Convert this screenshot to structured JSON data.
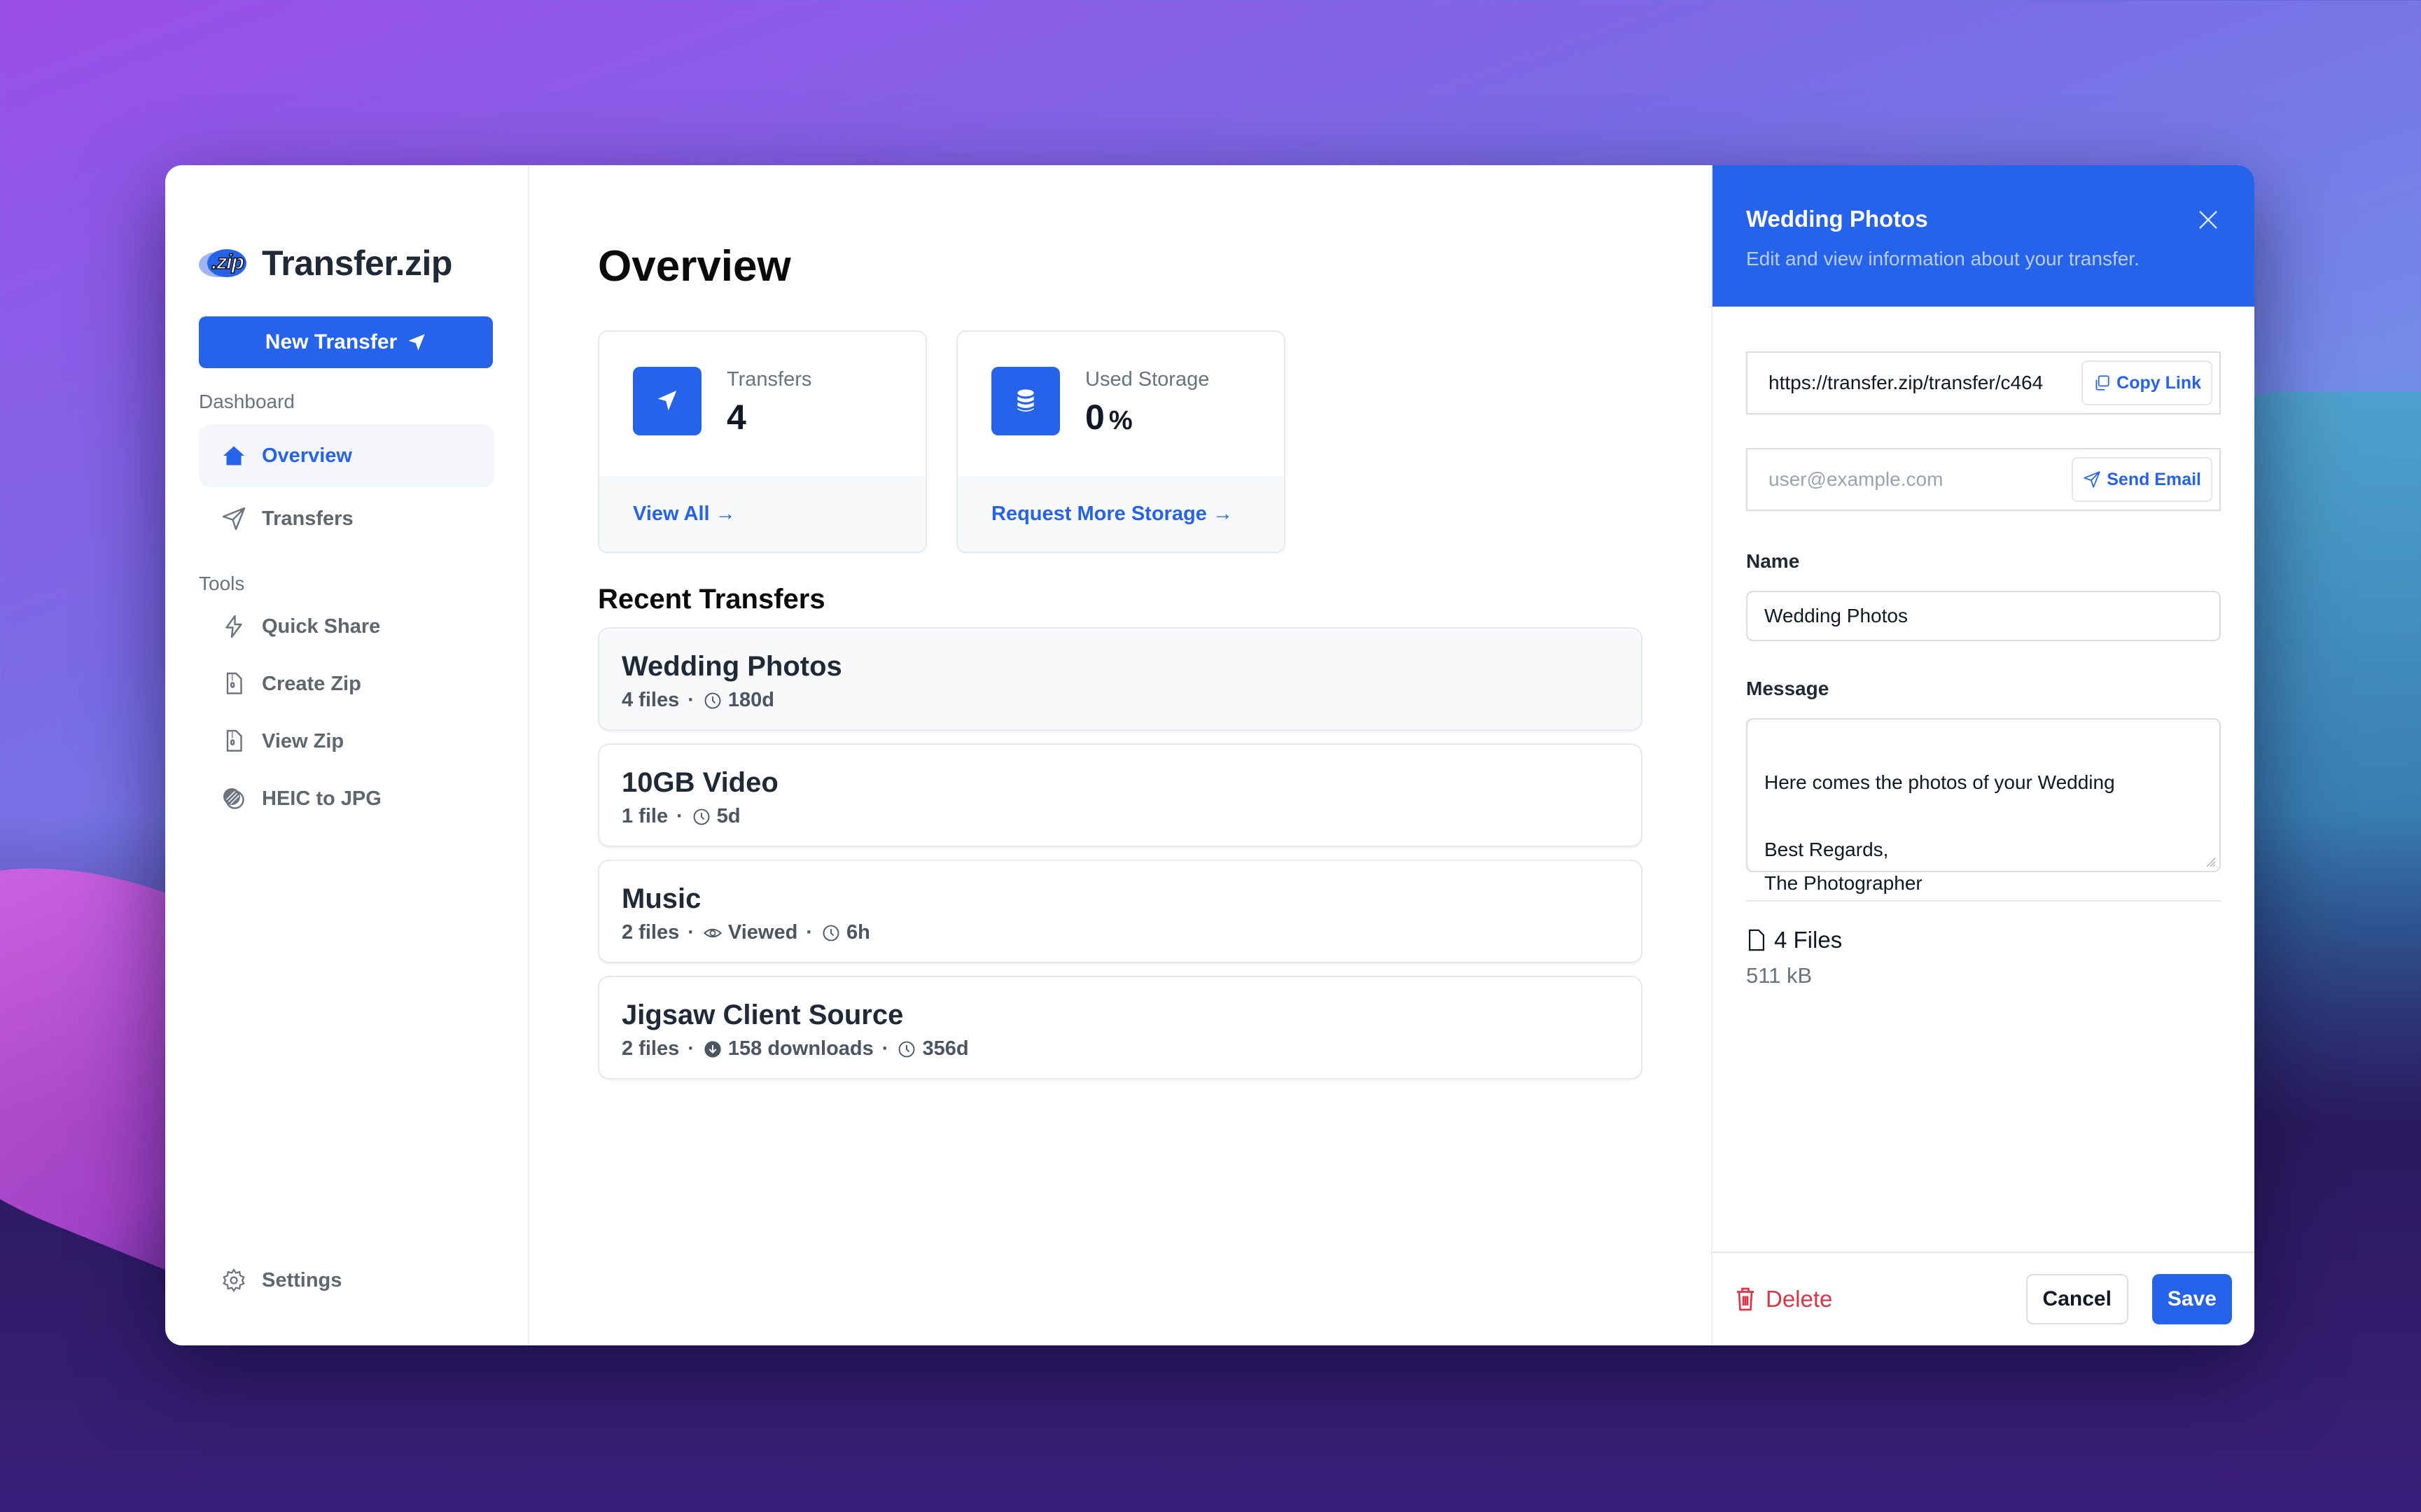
{
  "app": {
    "brand_logo_text": ".zip",
    "brand_name": "Transfer.zip",
    "accent_color": "#2563eb",
    "danger_color": "#dc3545"
  },
  "sidebar": {
    "new_transfer_label": "New Transfer",
    "dashboard_label": "Dashboard",
    "dashboard_items": [
      {
        "label": "Overview",
        "icon": "home-icon",
        "active": true
      },
      {
        "label": "Transfers",
        "icon": "paper-plane-icon",
        "active": false
      }
    ],
    "tools_label": "Tools",
    "tool_items": [
      {
        "label": "Quick Share",
        "icon": "bolt-icon"
      },
      {
        "label": "Create Zip",
        "icon": "zip-file-icon"
      },
      {
        "label": "View Zip",
        "icon": "zip-file-icon"
      },
      {
        "label": "HEIC to JPG",
        "icon": "image-convert-icon"
      }
    ],
    "settings_label": "Settings"
  },
  "main": {
    "title": "Overview",
    "stats": [
      {
        "label": "Transfers",
        "value": "4",
        "unit": "",
        "link": "View All →",
        "icon": "paper-plane-icon"
      },
      {
        "label": "Used Storage",
        "value": "0",
        "unit": "%",
        "link": "Request More Storage →",
        "icon": "database-icon"
      }
    ],
    "recent_title": "Recent Transfers",
    "transfers": [
      {
        "name": "Wedding Photos",
        "files": "4 files",
        "viewed": null,
        "downloads": null,
        "expires": "180d",
        "selected": true
      },
      {
        "name": "10GB Video",
        "files": "1 file",
        "viewed": null,
        "downloads": null,
        "expires": "5d",
        "selected": false
      },
      {
        "name": "Music",
        "files": "2 files",
        "viewed": "Viewed",
        "downloads": null,
        "expires": "6h",
        "selected": false
      },
      {
        "name": "Jigsaw Client Source",
        "files": "2 files",
        "viewed": null,
        "downloads": "158 downloads",
        "expires": "356d",
        "selected": false
      }
    ]
  },
  "panel": {
    "title": "Wedding Photos",
    "subtitle": "Edit and view information about your transfer.",
    "link_value": "https://transfer.zip/transfer/c464",
    "copy_link_label": "Copy Link",
    "email_placeholder": "user@example.com",
    "send_email_label": "Send Email",
    "name_label": "Name",
    "name_value": "Wedding Photos",
    "message_label": "Message",
    "message_value": "Here comes the photos of your Wedding\n\nBest Regards,\nThe Photographer",
    "files_count": "4 Files",
    "files_size": "511 kB",
    "delete_label": "Delete",
    "cancel_label": "Cancel",
    "save_label": "Save"
  }
}
